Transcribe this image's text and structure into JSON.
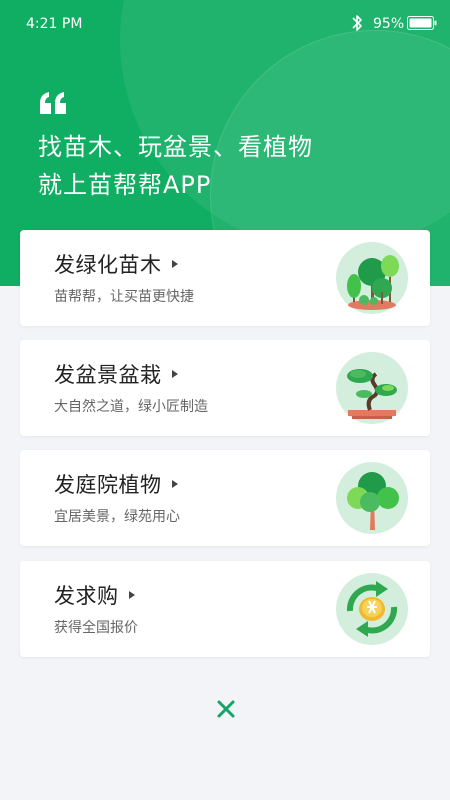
{
  "status_bar": {
    "time": "4:21 PM",
    "battery": "95%"
  },
  "header": {
    "line1": "找苗木、玩盆景、看植物",
    "line2": "就上苗帮帮APP"
  },
  "cards": [
    {
      "title": "发绿化苗木",
      "subtitle": "苗帮帮，让买苗更快捷",
      "icon": "green-trees-icon"
    },
    {
      "title": "发盆景盆栽",
      "subtitle": "大自然之道，绿小匠制造",
      "icon": "bonsai-icon"
    },
    {
      "title": "发庭院植物",
      "subtitle": "宜居美景，绿苑用心",
      "icon": "garden-tree-icon"
    },
    {
      "title": "发求购",
      "subtitle": "获得全国报价",
      "icon": "coin-exchange-icon"
    }
  ],
  "colors": {
    "brand_green": "#0fae62",
    "icon_bg": "#d3eedd",
    "close_green": "#13a566"
  }
}
